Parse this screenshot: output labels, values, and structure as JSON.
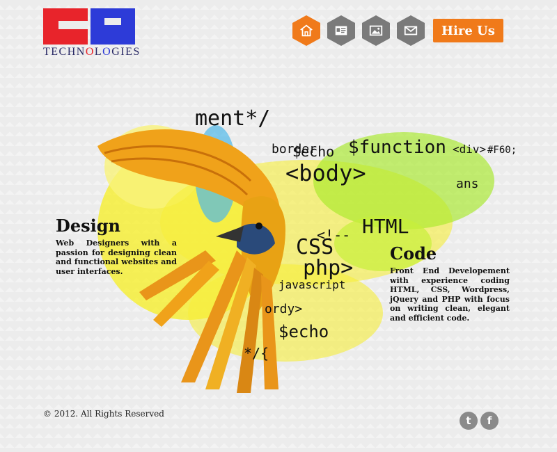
{
  "brand": {
    "logo_letters": "GR",
    "tagline_parts": [
      "TECHN",
      "O",
      "L",
      "O",
      "GIES"
    ]
  },
  "nav": {
    "items": [
      {
        "icon": "home-icon",
        "active": true
      },
      {
        "icon": "id-card-icon",
        "active": false
      },
      {
        "icon": "image-icon",
        "active": false
      },
      {
        "icon": "mail-icon",
        "active": false
      }
    ],
    "hire_label": "Hire Us"
  },
  "hero": {
    "code_words": [
      "border",
      "$echo",
      "$function",
      "<div>",
      "#F60;",
      "<body>",
      "HTML",
      "CSS",
      "php>",
      "javascript",
      "<!--",
      "*/{",
      "ment*/",
      "ordy>",
      "ans"
    ]
  },
  "design": {
    "title": "Design",
    "text": "Web Designers with a passion for designing clean and functional websites and user interfaces."
  },
  "code": {
    "title": "Code",
    "text": "Front End Developement with experience coding HTML, CSS, Wordpress, jQuery and PHP with focus on writing clean, elegant and efficient code."
  },
  "footer": {
    "copyright": "© 2012. All Rights Reserved",
    "twitter_glyph": "t",
    "facebook_glyph": "f"
  },
  "colors": {
    "accent": "#f07a1a",
    "nav_gray": "#7a7a7a",
    "logo_red": "#e8242b",
    "logo_blue": "#2d3bd8",
    "paint_yellow": "#f6ef3a",
    "paint_green": "#a8ea2a"
  }
}
